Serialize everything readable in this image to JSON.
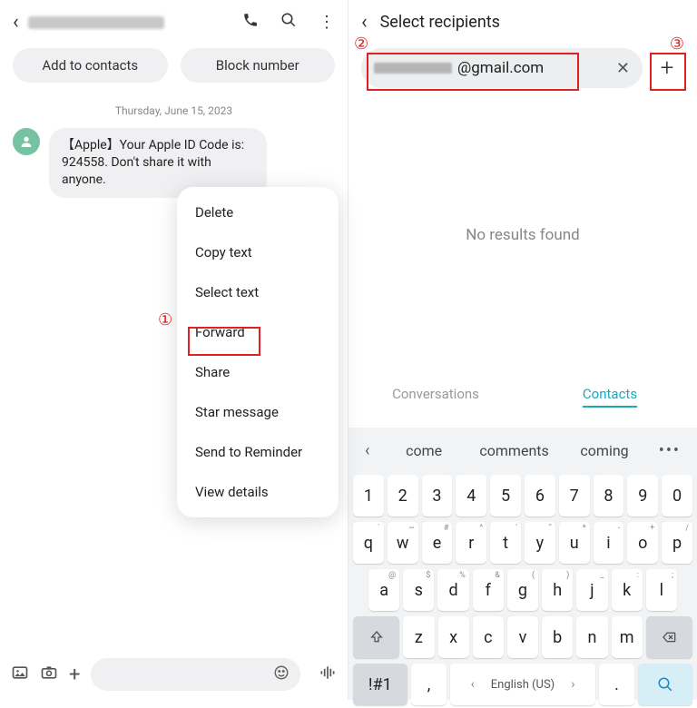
{
  "left": {
    "chips": {
      "add": "Add to contacts",
      "block": "Block number"
    },
    "date": "Thursday, June 15, 2023",
    "message": "【Apple】Your Apple ID Code is: 924558. Don't share it with anyone.",
    "menu": {
      "delete": "Delete",
      "copy": "Copy text",
      "select": "Select text",
      "forward": "Forward",
      "share": "Share",
      "star": "Star message",
      "reminder": "Send to Reminder",
      "details": "View details"
    },
    "annot1": "①"
  },
  "right": {
    "title": "Select recipients",
    "email_domain": "@gmail.com",
    "noresults": "No results found",
    "tabs": {
      "conversations": "Conversations",
      "contacts": "Contacts"
    },
    "annot2": "②",
    "annot3": "③"
  },
  "kbd": {
    "sugg": {
      "s1": "come",
      "s2": "comments",
      "s3": "coming"
    },
    "row1": [
      "1",
      "2",
      "3",
      "4",
      "5",
      "6",
      "7",
      "8",
      "9",
      "0"
    ],
    "row2": {
      "keys": [
        "q",
        "w",
        "e",
        "r",
        "t",
        "y",
        "u",
        "i",
        "o",
        "p"
      ],
      "sup": [
        "`",
        "~",
        "#",
        "^",
        "'",
        "\"",
        "*",
        "-",
        "+",
        "/"
      ]
    },
    "row3": {
      "keys": [
        "a",
        "s",
        "d",
        "f",
        "g",
        "h",
        "j",
        "k",
        "l"
      ],
      "sup": [
        "@",
        "$",
        "%",
        "&",
        "(",
        ")",
        "_",
        ":",
        ";"
      ]
    },
    "row4": [
      "z",
      "x",
      "c",
      "v",
      "b",
      "n",
      "m"
    ],
    "bottom": {
      "sym": "!#1",
      "comma": ",",
      "lang": "English (US)",
      "dot": "."
    }
  }
}
